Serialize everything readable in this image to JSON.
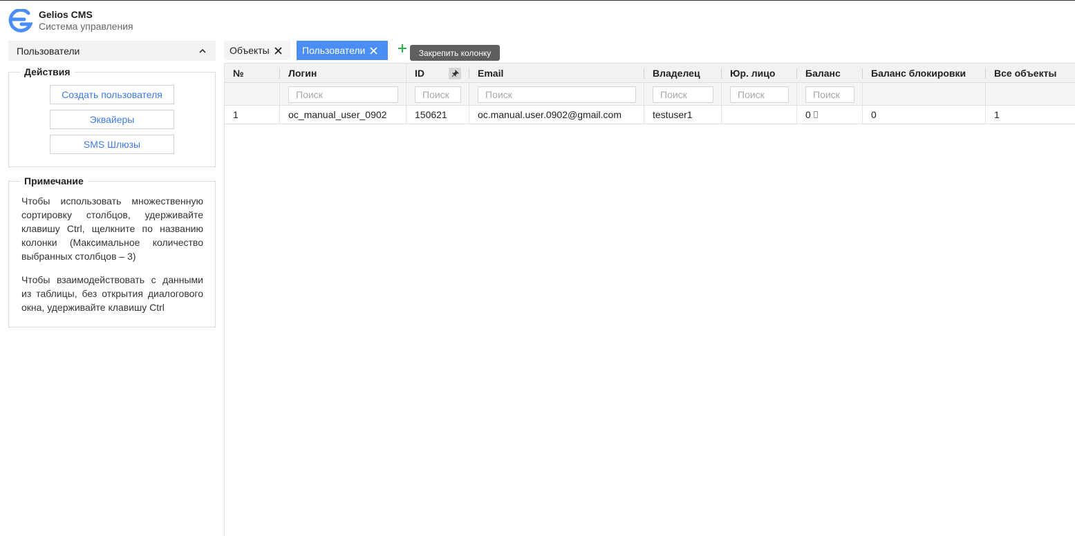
{
  "app": {
    "title": "Gelios CMS",
    "subtitle": "Система управления"
  },
  "sidebar": {
    "section_title": "Пользователи",
    "actions": {
      "legend": "Действия",
      "buttons": [
        "Создать пользователя",
        "Эквайеры",
        "SMS Шлюзы"
      ]
    },
    "note": {
      "legend": "Примечание",
      "paragraphs": [
        "Чтобы использовать множественную сортировку столбцов, удерживайте клавишу Ctrl, щелкните по названию колонки (Максимальное количество выбранных столбцов – 3)",
        "Чтобы взаимодействовать с данными из таблицы, без открытия диалогового окна, удерживайте клавишу Ctrl"
      ]
    }
  },
  "tabs": [
    {
      "label": "Объекты",
      "active": false
    },
    {
      "label": "Пользователи",
      "active": true
    }
  ],
  "tooltip": "Закрепить колонку",
  "colors": {
    "accent": "#4a8df5",
    "link": "#3e7be0",
    "add": "#2bb34a"
  },
  "icons": [
    "logo-icon",
    "chevron-up-icon",
    "close-icon",
    "plus-icon",
    "pin-icon"
  ],
  "table": {
    "columns": [
      "№",
      "Логин",
      "ID",
      "Email",
      "Владелец",
      "Юр. лицо",
      "Баланс",
      "Баланс блокировки",
      "Все объекты"
    ],
    "filter_placeholder": "Поиск",
    "rows": [
      {
        "num": "1",
        "login": "oc_manual_user_0902",
        "id": "150621",
        "email": "oc.manual.user.0902@gmail.com",
        "owner": "testuser1",
        "legal_entity": "",
        "balance": "0",
        "blocked_balance": "0",
        "all_objects": "1"
      }
    ]
  }
}
